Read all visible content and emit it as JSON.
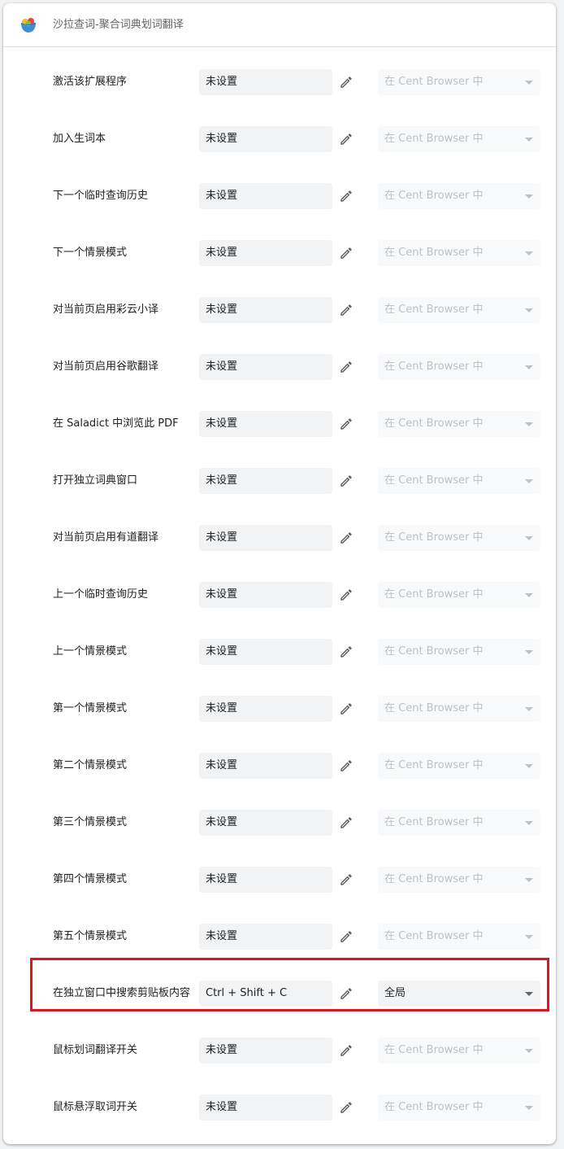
{
  "header": {
    "title": "沙拉查词-聚合词典划词翻译",
    "logo_icon": "saladict-logo-icon"
  },
  "highlight_color": "#e0151b",
  "rows": [
    {
      "label": "激活该扩展程序",
      "shortcut": "未设置",
      "scope": "在 Cent Browser 中",
      "scope_enabled": false
    },
    {
      "label": "加入生词本",
      "shortcut": "未设置",
      "scope": "在 Cent Browser 中",
      "scope_enabled": false
    },
    {
      "label": "下一个临时查询历史",
      "shortcut": "未设置",
      "scope": "在 Cent Browser 中",
      "scope_enabled": false
    },
    {
      "label": "下一个情景模式",
      "shortcut": "未设置",
      "scope": "在 Cent Browser 中",
      "scope_enabled": false
    },
    {
      "label": "对当前页启用彩云小译",
      "shortcut": "未设置",
      "scope": "在 Cent Browser 中",
      "scope_enabled": false
    },
    {
      "label": "对当前页启用谷歌翻译",
      "shortcut": "未设置",
      "scope": "在 Cent Browser 中",
      "scope_enabled": false
    },
    {
      "label": "在 Saladict 中浏览此 PDF",
      "shortcut": "未设置",
      "scope": "在 Cent Browser 中",
      "scope_enabled": false
    },
    {
      "label": "打开独立词典窗口",
      "shortcut": "未设置",
      "scope": "在 Cent Browser 中",
      "scope_enabled": false
    },
    {
      "label": "对当前页启用有道翻译",
      "shortcut": "未设置",
      "scope": "在 Cent Browser 中",
      "scope_enabled": false
    },
    {
      "label": "上一个临时查询历史",
      "shortcut": "未设置",
      "scope": "在 Cent Browser 中",
      "scope_enabled": false
    },
    {
      "label": "上一个情景模式",
      "shortcut": "未设置",
      "scope": "在 Cent Browser 中",
      "scope_enabled": false
    },
    {
      "label": "第一个情景模式",
      "shortcut": "未设置",
      "scope": "在 Cent Browser 中",
      "scope_enabled": false
    },
    {
      "label": "第二个情景模式",
      "shortcut": "未设置",
      "scope": "在 Cent Browser 中",
      "scope_enabled": false
    },
    {
      "label": "第三个情景模式",
      "shortcut": "未设置",
      "scope": "在 Cent Browser 中",
      "scope_enabled": false
    },
    {
      "label": "第四个情景模式",
      "shortcut": "未设置",
      "scope": "在 Cent Browser 中",
      "scope_enabled": false
    },
    {
      "label": "第五个情景模式",
      "shortcut": "未设置",
      "scope": "在 Cent Browser 中",
      "scope_enabled": false
    },
    {
      "label": "在独立窗口中搜索剪贴板内容",
      "shortcut": "Ctrl + Shift + C",
      "scope": "全局",
      "scope_enabled": true,
      "highlighted": true
    },
    {
      "label": "鼠标划词翻译开关",
      "shortcut": "未设置",
      "scope": "在 Cent Browser 中",
      "scope_enabled": false
    },
    {
      "label": "鼠标悬浮取词开关",
      "shortcut": "未设置",
      "scope": "在 Cent Browser 中",
      "scope_enabled": false
    }
  ]
}
